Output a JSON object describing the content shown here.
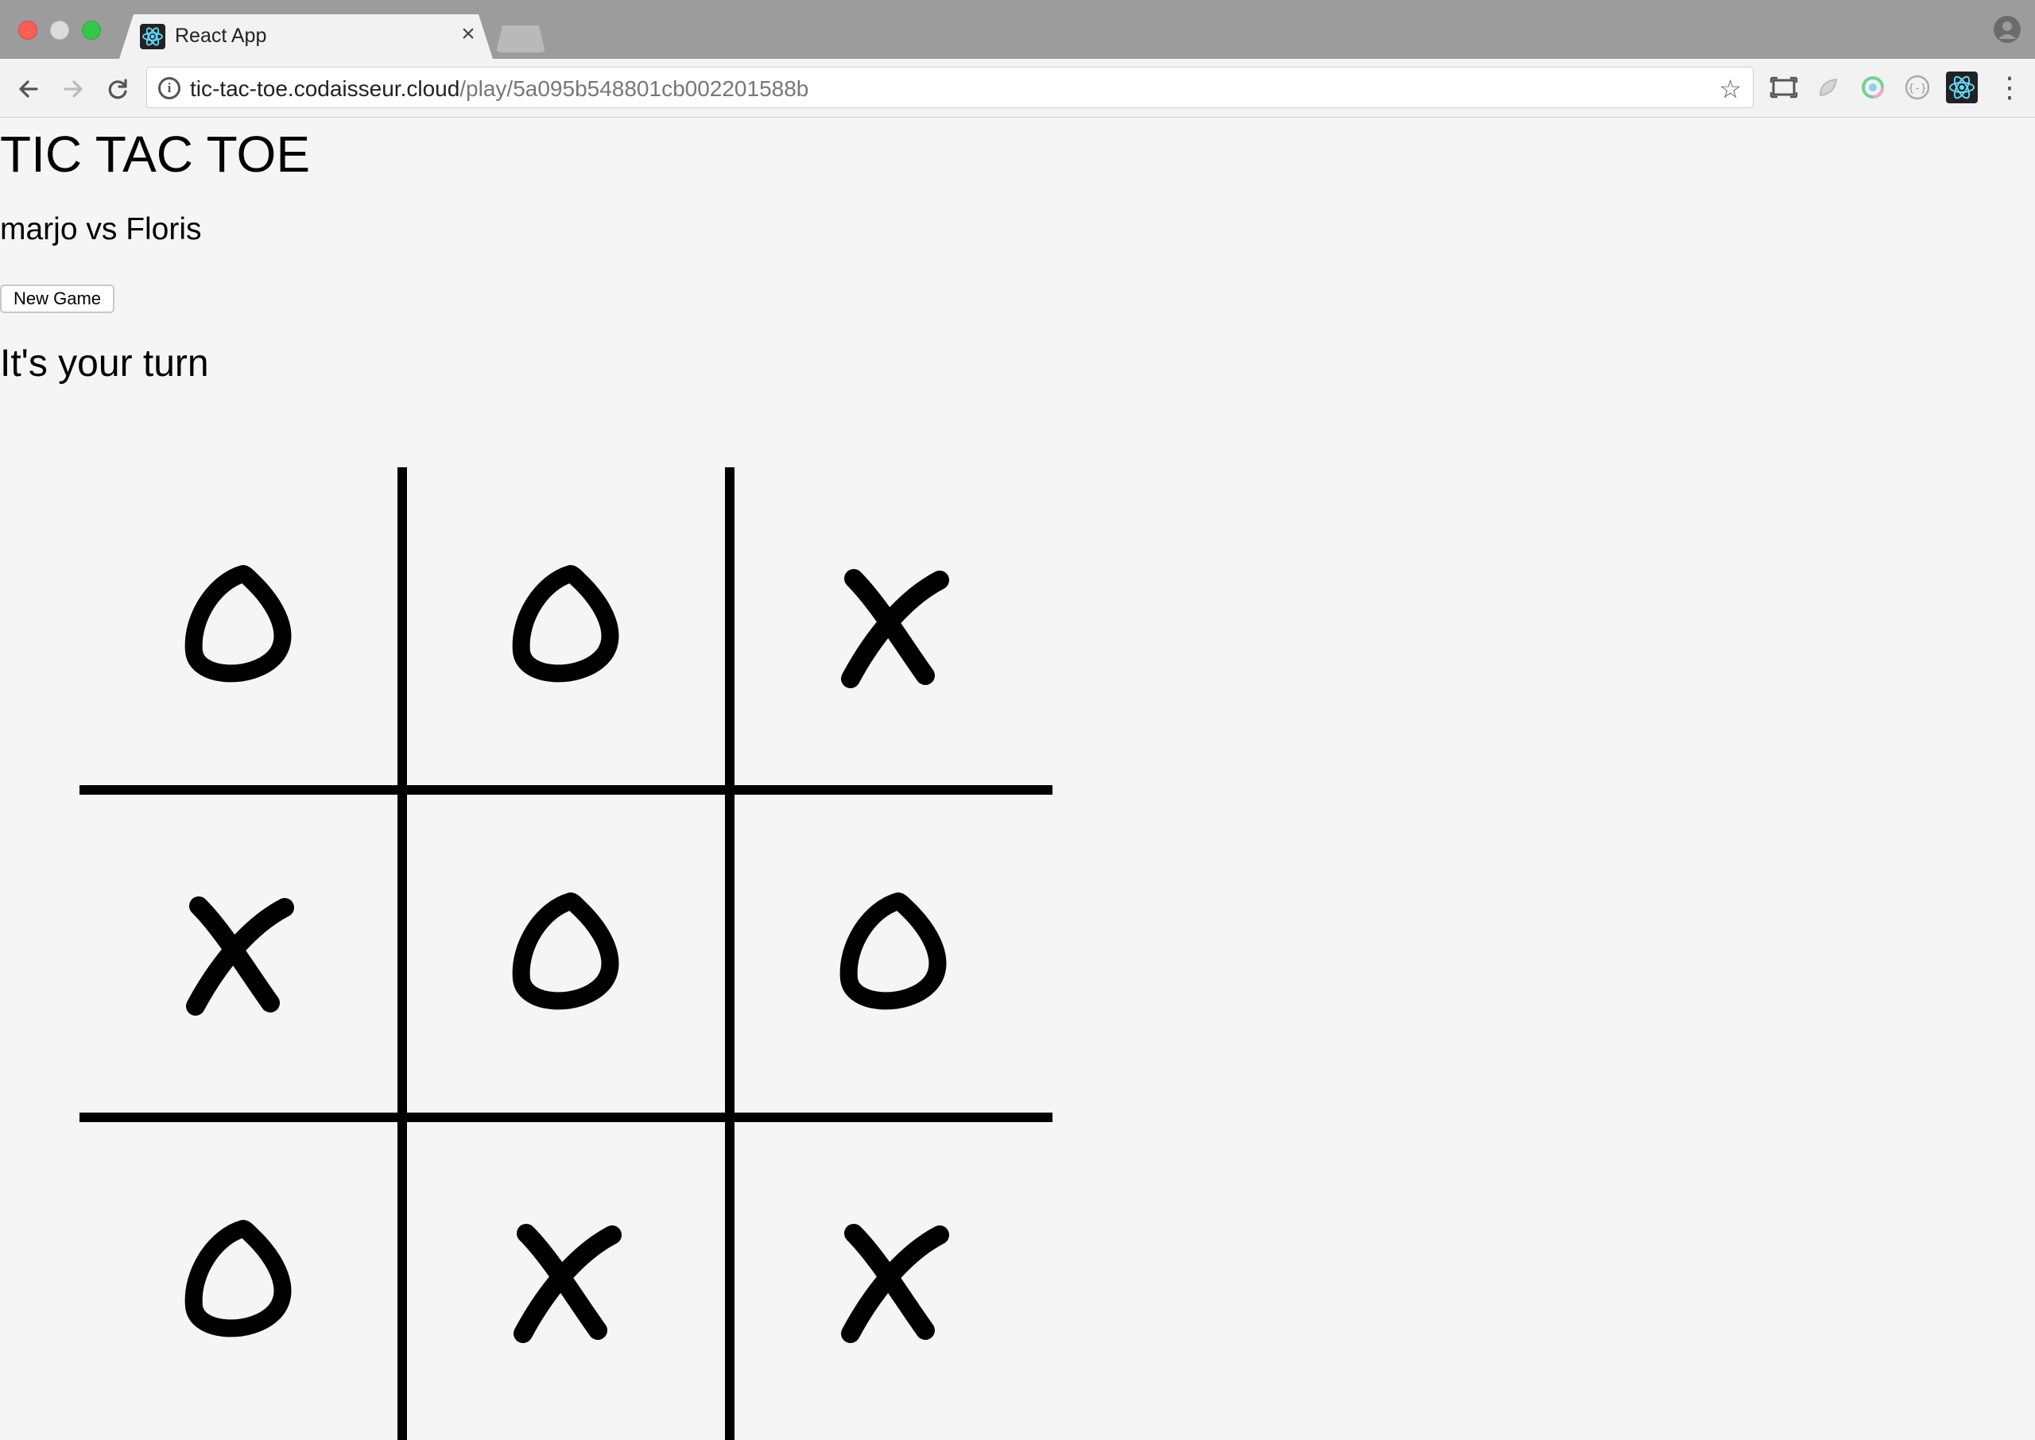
{
  "browser": {
    "tab_title": "React App",
    "tab_close": "×",
    "url_host": "tic-tac-toe.codaisseur.cloud",
    "url_path": "/play/5a095b548801cb002201588b",
    "info_icon": "i",
    "star_icon": "☆",
    "menu_icon": "⋮"
  },
  "page": {
    "title": "TIC TAC TOE",
    "players": "marjo vs Floris",
    "new_game_label": "New Game",
    "status": "It's your turn"
  },
  "board": {
    "cells": [
      "O",
      "O",
      "X",
      "X",
      "O",
      "O",
      "O",
      "X",
      "X"
    ]
  },
  "colors": {
    "page_bg": "#f5f5f5",
    "mark": "#000000"
  }
}
